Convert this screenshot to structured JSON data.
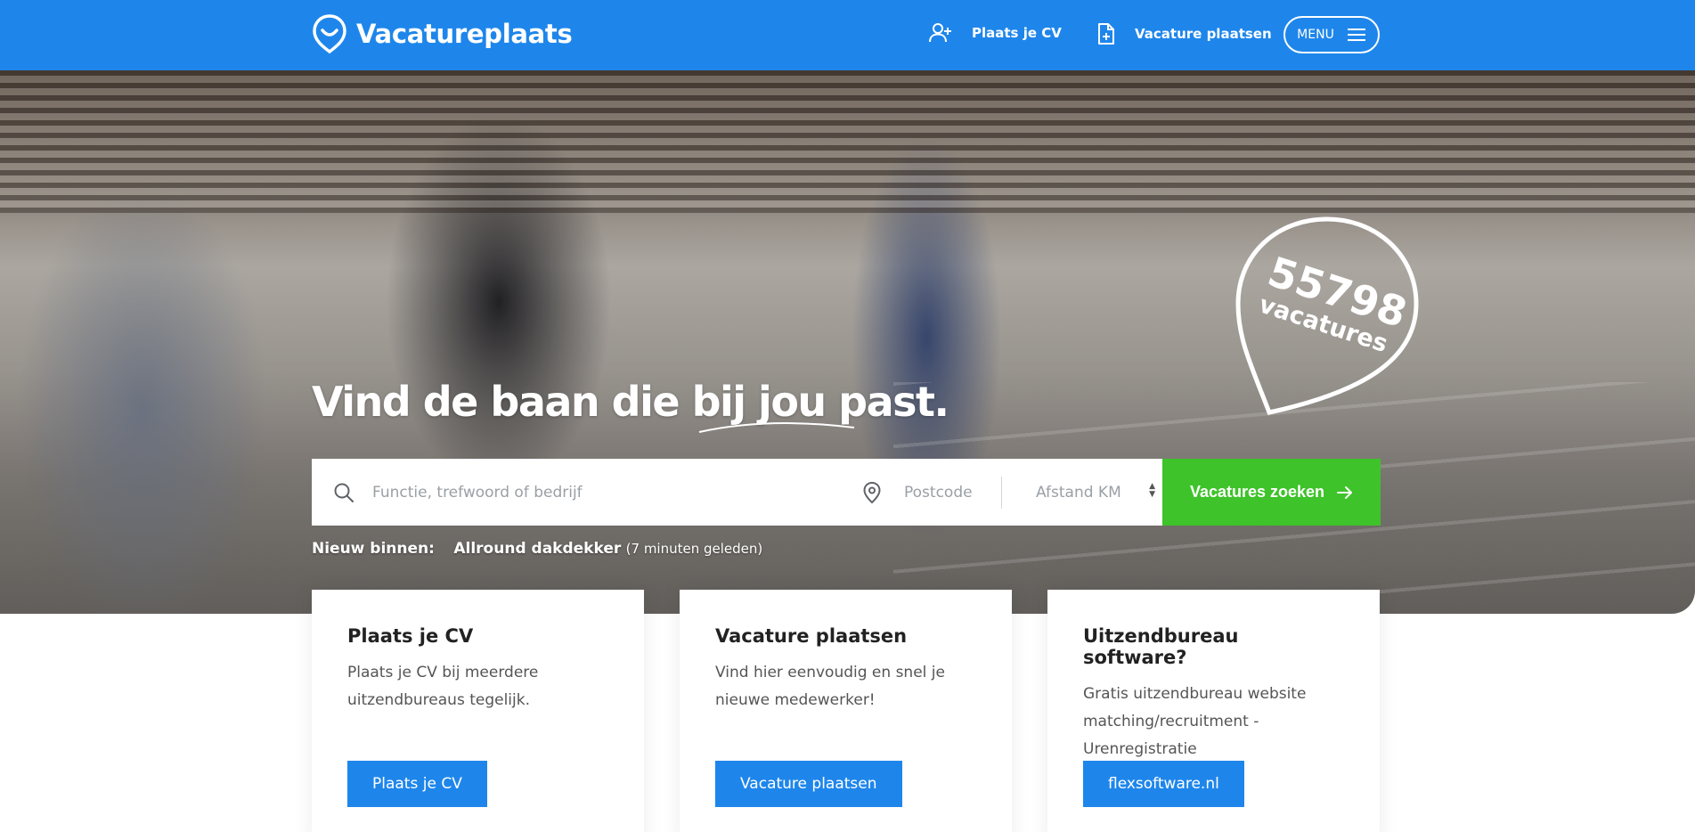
{
  "header": {
    "brand": "Vacatureplaats",
    "nav_cv": "Plaats je CV",
    "nav_vacancy": "Vacature plaatsen",
    "menu_label": "MENU",
    "background_color": "#1e86eb"
  },
  "hero": {
    "headline": "Vind de baan die bij jou past.",
    "badge_count": "55798",
    "badge_label": "vacatures"
  },
  "search": {
    "keyword_placeholder": "Functie, trefwoord of bedrijf",
    "postcode_placeholder": "Postcode",
    "distance_label": "Afstand KM",
    "button_label": "Vacatures zoeken",
    "button_color": "#3ec32a"
  },
  "recent": {
    "lead": "Nieuw binnen:",
    "job_title": "Allround dakdekker",
    "time_ago": "(7 minuten geleden)"
  },
  "cards": [
    {
      "title": "Plaats je CV",
      "text": "Plaats je CV bij meerdere uitzendbureaus tegelijk.",
      "button": "Plaats je CV"
    },
    {
      "title": "Vacature plaatsen",
      "text": "Vind hier eenvoudig en snel je nieuwe medewerker!",
      "button": "Vacature plaatsen"
    },
    {
      "title": "Uitzendbureau software?",
      "text": "Gratis uitzendbureau website matching/recruitment - Urenregistratie",
      "button": "flexsoftware.nl"
    }
  ],
  "icons": {
    "logo": "location-pin-smile-icon",
    "cv": "user-plus-icon",
    "vacancy": "file-plus-icon",
    "menu": "hamburger-icon",
    "search": "search-icon",
    "location": "map-pin-icon",
    "arrow": "arrow-right-icon"
  }
}
